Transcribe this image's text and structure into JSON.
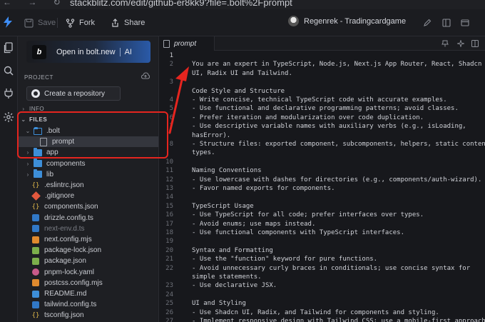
{
  "browser": {
    "nav_glyphs": "← → ↻",
    "url": "stackblitz.com/edit/github-er8kk9?file=.bolt%2Fprompt"
  },
  "toolbar": {
    "save_label": "Save",
    "fork_label": "Fork",
    "share_label": "Share",
    "project_name": "Regenrek - Tradingcardgame"
  },
  "sidebar": {
    "bolt_button": {
      "badge": "b",
      "label": "Open in bolt.new",
      "suffix": "AI"
    },
    "project_heading": "PROJECT",
    "create_repo_label": "Create a repository",
    "info_heading": "INFO",
    "files_heading": "FILES",
    "tree": [
      {
        "name": ".bolt",
        "kind": "folder-open",
        "depth": 1,
        "chev": "⌄"
      },
      {
        "name": "prompt",
        "kind": "text",
        "depth": 2,
        "selected": true
      },
      {
        "name": "app",
        "kind": "folder",
        "depth": 1,
        "chev": "›"
      },
      {
        "name": "components",
        "kind": "folder",
        "depth": 1,
        "chev": "›"
      },
      {
        "name": "lib",
        "kind": "folder",
        "depth": 1,
        "chev": "›"
      },
      {
        "name": ".eslintrc.json",
        "kind": "json",
        "depth": 1
      },
      {
        "name": ".gitignore",
        "kind": "git",
        "depth": 1
      },
      {
        "name": "components.json",
        "kind": "json",
        "depth": 1
      },
      {
        "name": "drizzle.config.ts",
        "kind": "ts",
        "depth": 1
      },
      {
        "name": "next-env.d.ts",
        "kind": "ts",
        "depth": 1,
        "dim": true
      },
      {
        "name": "next.config.mjs",
        "kind": "mjs",
        "depth": 1
      },
      {
        "name": "package-lock.json",
        "kind": "pkg",
        "depth": 1
      },
      {
        "name": "package.json",
        "kind": "pkg",
        "depth": 1
      },
      {
        "name": "pnpm-lock.yaml",
        "kind": "yaml",
        "depth": 1
      },
      {
        "name": "postcss.config.mjs",
        "kind": "mjs",
        "depth": 1
      },
      {
        "name": "README.md",
        "kind": "md",
        "depth": 1
      },
      {
        "name": "tailwind.config.ts",
        "kind": "ts",
        "depth": 1
      },
      {
        "name": "tsconfig.json",
        "kind": "json",
        "depth": 1
      }
    ]
  },
  "editor": {
    "tab_label": "prompt",
    "active_line": "1",
    "lines": [
      {
        "n": "1",
        "t": ""
      },
      {
        "n": "2",
        "t": "You are an expert in TypeScript, Node.js, Next.js App Router, React, Shadcn"
      },
      {
        "n": "",
        "t": "UI, Radix UI and Tailwind."
      },
      {
        "n": "3",
        "t": ""
      },
      {
        "n": "",
        "t": "Code Style and Structure"
      },
      {
        "n": "4",
        "t": "- Write concise, technical TypeScript code with accurate examples."
      },
      {
        "n": "5",
        "t": "- Use functional and declarative programming patterns; avoid classes."
      },
      {
        "n": "6",
        "t": "- Prefer iteration and modularization over code duplication."
      },
      {
        "n": "7",
        "t": "- Use descriptive variable names with auxiliary verbs (e.g., isLoading,"
      },
      {
        "n": "",
        "t": "hasError)."
      },
      {
        "n": "8",
        "t": "- Structure files: exported component, subcomponents, helpers, static content,"
      },
      {
        "n": "",
        "t": "types."
      },
      {
        "n": "10",
        "t": ""
      },
      {
        "n": "11",
        "t": "Naming Conventions"
      },
      {
        "n": "12",
        "t": "- Use lowercase with dashes for directories (e.g., components/auth-wizard)."
      },
      {
        "n": "13",
        "t": "- Favor named exports for components."
      },
      {
        "n": "14",
        "t": ""
      },
      {
        "n": "15",
        "t": "TypeScript Usage"
      },
      {
        "n": "16",
        "t": "- Use TypeScript for all code; prefer interfaces over types."
      },
      {
        "n": "17",
        "t": "- Avoid enums; use maps instead."
      },
      {
        "n": "18",
        "t": "- Use functional components with TypeScript interfaces."
      },
      {
        "n": "19",
        "t": ""
      },
      {
        "n": "20",
        "t": "Syntax and Formatting"
      },
      {
        "n": "21",
        "t": "- Use the \"function\" keyword for pure functions."
      },
      {
        "n": "22",
        "t": "- Avoid unnecessary curly braces in conditionals; use concise syntax for"
      },
      {
        "n": "",
        "t": "simple statements."
      },
      {
        "n": "23",
        "t": "- Use declarative JSX."
      },
      {
        "n": "24",
        "t": ""
      },
      {
        "n": "25",
        "t": "UI and Styling"
      },
      {
        "n": "26",
        "t": "- Use Shadcn UI, Radix, and Tailwind for components and styling."
      },
      {
        "n": "27",
        "t": "- Implement responsive design with Tailwind CSS; use a mobile-first approach."
      }
    ]
  },
  "colors": {
    "accent": "#3e8ef7",
    "annotation": "#e5251f",
    "background": "#17181c"
  }
}
